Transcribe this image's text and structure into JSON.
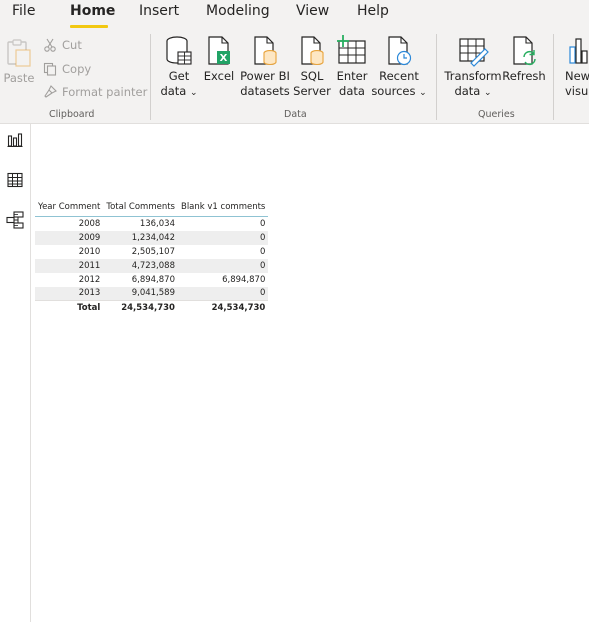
{
  "menu": {
    "tabs": [
      {
        "label": "File"
      },
      {
        "label": "Home"
      },
      {
        "label": "Insert"
      },
      {
        "label": "Modeling"
      },
      {
        "label": "View"
      },
      {
        "label": "Help"
      }
    ]
  },
  "ribbon": {
    "clipboard": {
      "group_label": "Clipboard",
      "paste": "Paste",
      "cut": "Cut",
      "copy": "Copy",
      "format_painter": "Format painter"
    },
    "data": {
      "group_label": "Data",
      "get_data": {
        "line1": "Get",
        "line2": "data"
      },
      "excel": {
        "line1": "Excel"
      },
      "powerbi_datasets": {
        "line1": "Power BI",
        "line2": "datasets"
      },
      "sql_server": {
        "line1": "SQL",
        "line2": "Server"
      },
      "enter_data": {
        "line1": "Enter",
        "line2": "data"
      },
      "recent_sources": {
        "line1": "Recent",
        "line2": "sources"
      }
    },
    "queries": {
      "group_label": "Queries",
      "transform_data": {
        "line1": "Transform",
        "line2": "data"
      },
      "refresh": {
        "line1": "Refresh"
      }
    },
    "insert": {
      "new_visual": {
        "line1": "New",
        "line2": "visual"
      }
    }
  },
  "colors": {
    "accent": "#f2c811",
    "excel_green": "#21a366",
    "database_orange": "#e8a33b",
    "refresh_green": "#27ae60",
    "icon_blue": "#2b88d8",
    "table_header_border": "#8fc3d3"
  },
  "rail": {
    "items": [
      {
        "icon": "report-view-icon"
      },
      {
        "icon": "data-view-icon"
      },
      {
        "icon": "model-view-icon"
      }
    ]
  },
  "table": {
    "columns": [
      "Year Comment",
      "Total Comments",
      "Blank v1 comments"
    ],
    "rows": [
      [
        "2008",
        "136,034",
        "0"
      ],
      [
        "2009",
        "1,234,042",
        "0"
      ],
      [
        "2010",
        "2,505,107",
        "0"
      ],
      [
        "2011",
        "4,723,088",
        "0"
      ],
      [
        "2012",
        "6,894,870",
        "6,894,870"
      ],
      [
        "2013",
        "9,041,589",
        "0"
      ]
    ],
    "total": [
      "Total",
      "24,534,730",
      "24,534,730"
    ]
  }
}
